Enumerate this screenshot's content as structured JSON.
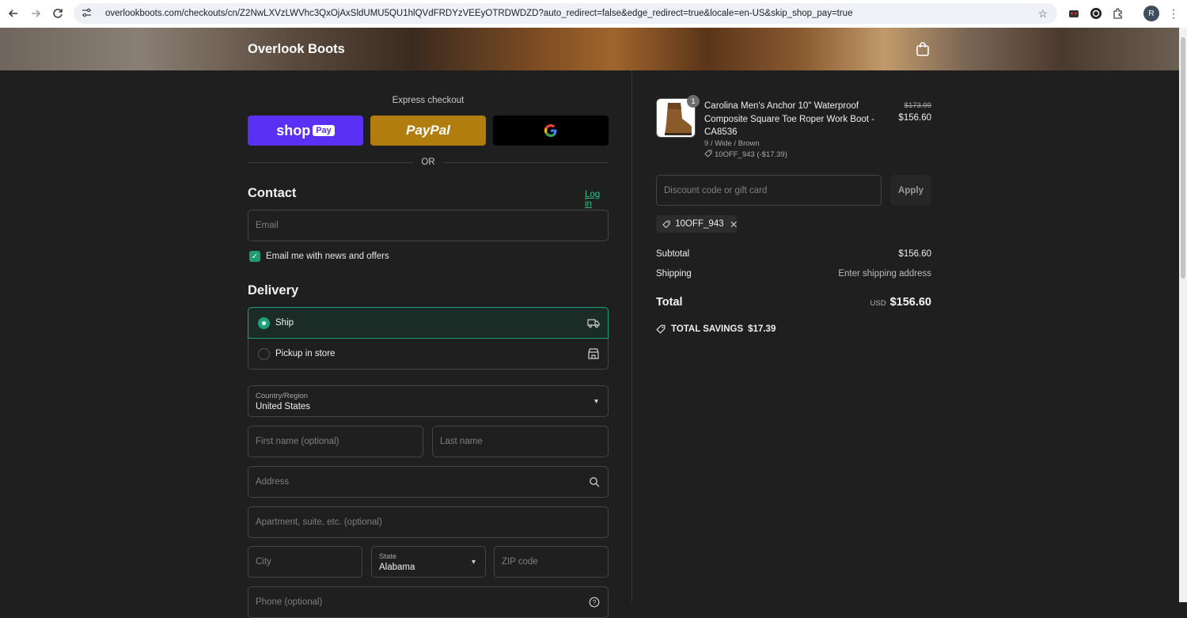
{
  "browser": {
    "url": "overlookboots.com/checkouts/cn/Z2NwLXVzLWVhc3QxOjAxSldUMU5QU1hlQVdFRDYzVEEyOTRDWDZD?auto_redirect=false&edge_redirect=true&locale=en-US&skip_shop_pay=true",
    "profile_initial": "R"
  },
  "header": {
    "brand": "Overlook Boots"
  },
  "express": {
    "label": "Express checkout",
    "shoppay_text": "shop",
    "shoppay_badge": "Pay",
    "paypal_text": "PayPal",
    "gpay_text": "G",
    "or_text": "OR"
  },
  "contact": {
    "title": "Contact",
    "login_label": "Log in",
    "email_placeholder": "Email",
    "newsletter_label": "Email me with news and offers",
    "newsletter_checked": true
  },
  "delivery": {
    "title": "Delivery",
    "options": [
      {
        "label": "Ship",
        "selected": true
      },
      {
        "label": "Pickup in store",
        "selected": false
      }
    ],
    "country_label": "Country/Region",
    "country_value": "United States",
    "first_name_placeholder": "First name (optional)",
    "last_name_placeholder": "Last name",
    "address_placeholder": "Address",
    "apartment_placeholder": "Apartment, suite, etc. (optional)",
    "city_placeholder": "City",
    "state_label": "State",
    "state_value": "Alabama",
    "zip_placeholder": "ZIP code",
    "phone_placeholder": "Phone (optional)"
  },
  "summary": {
    "item": {
      "quantity": "1",
      "name": "Carolina Men's Anchor 10\" Waterproof Composite Square Toe Roper Work Boot - CA8536",
      "variant": "9 / Wide / Brown",
      "discount": "10OFF_943 (-$17.39)",
      "old_price": "$173.99",
      "price": "$156.60"
    },
    "discount_placeholder": "Discount code or gift card",
    "apply_label": "Apply",
    "applied_code": "10OFF_943",
    "subtotal_label": "Subtotal",
    "subtotal_value": "$156.60",
    "shipping_label": "Shipping",
    "shipping_value": "Enter shipping address",
    "total_label": "Total",
    "total_currency": "USD",
    "total_value": "$156.60",
    "savings_label": "TOTAL SAVINGS",
    "savings_value": "$17.39"
  },
  "colors": {
    "accent": "#1fa07a",
    "shoppay": "#5a31f4",
    "paypal": "#b07d0e",
    "background": "#1f1f1f"
  }
}
